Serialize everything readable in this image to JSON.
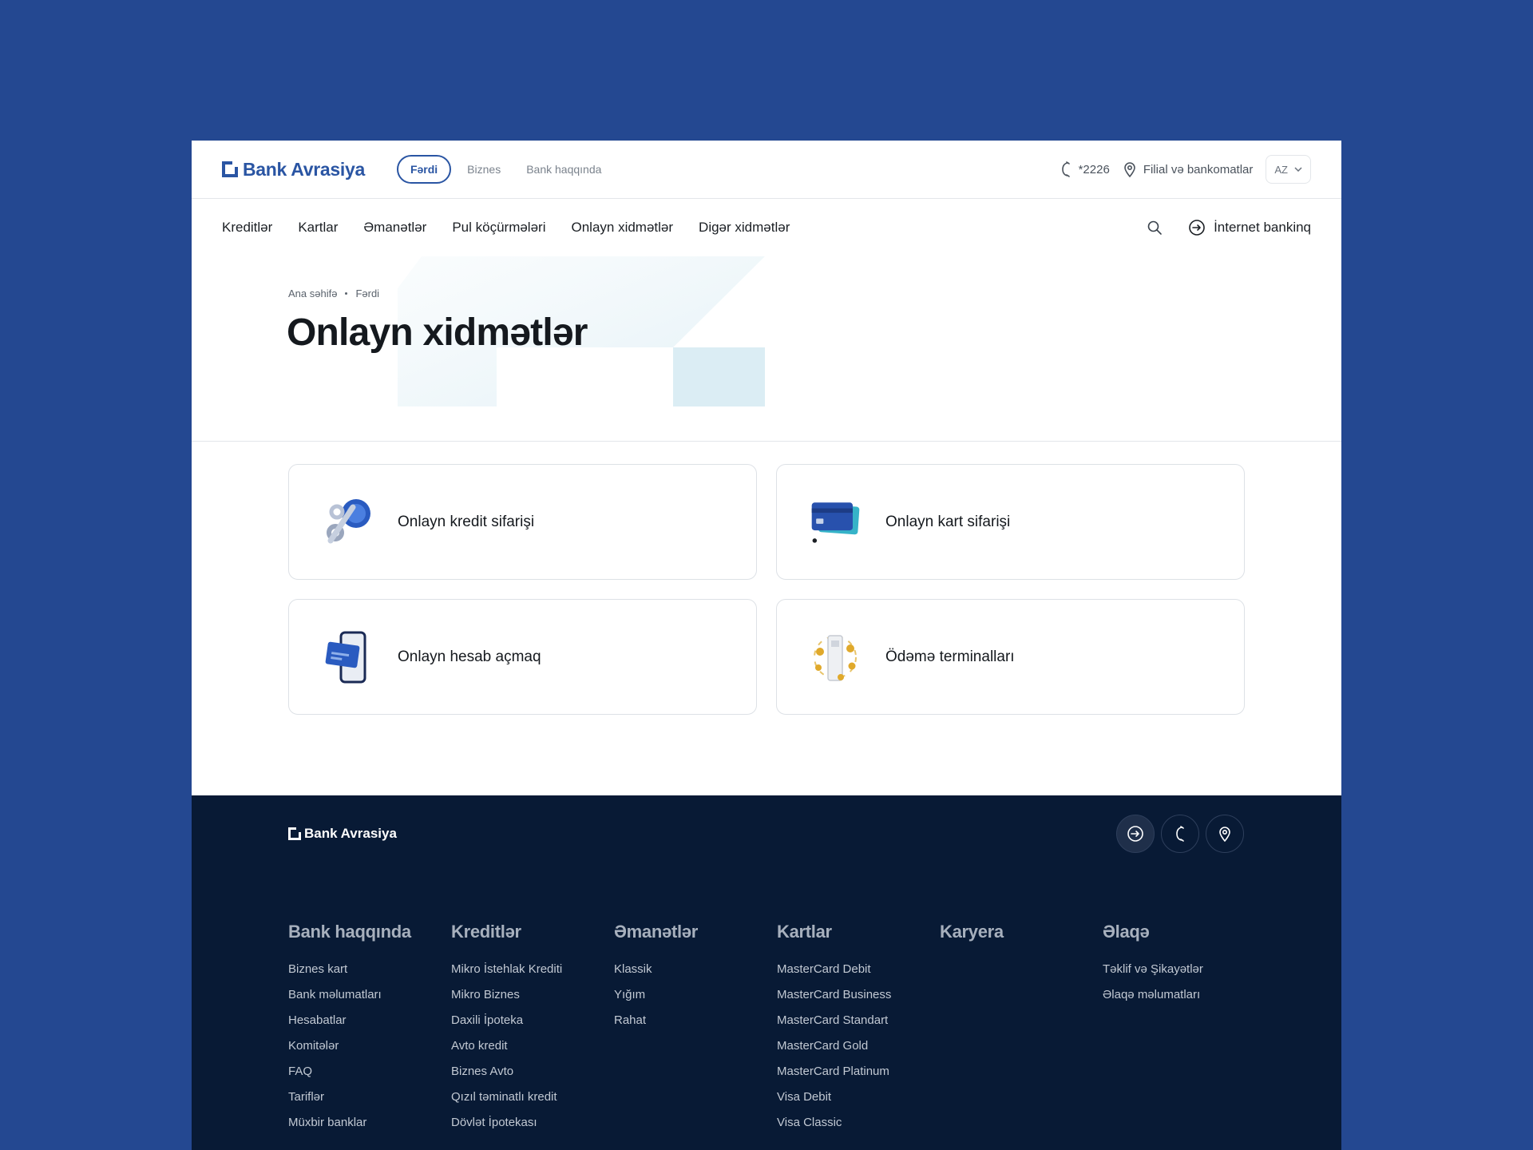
{
  "header": {
    "brand": "Bank Avrasiya",
    "segments": [
      "Fərdi",
      "Biznes",
      "Bank haqqında"
    ],
    "phone": "*2226",
    "branches": "Filial və bankomatlar",
    "lang": "AZ"
  },
  "nav": {
    "items": [
      "Kreditlər",
      "Kartlar",
      "Əmanətlər",
      "Pul köçürmələri",
      "Onlayn xidmətlər",
      "Digər xidmətlər"
    ],
    "internet_banking": "İnternet bankinq"
  },
  "breadcrumb": [
    "Ana səhifə",
    "Fərdi"
  ],
  "page_title": "Onlayn xidmətlər",
  "cards": [
    {
      "label": "Onlayn kredit sifarişi",
      "icon": "percent-coin-icon"
    },
    {
      "label": "Onlayn kart sifarişi",
      "icon": "credit-card-icon"
    },
    {
      "label": "Onlayn hesab açmaq",
      "icon": "phone-card-icon"
    },
    {
      "label": "Ödəmə terminalları",
      "icon": "payment-terminal-icon"
    }
  ],
  "footer": {
    "brand": "Bank Avrasiya",
    "columns": [
      {
        "title": "Bank haqqında",
        "links": [
          "Biznes kart",
          "Bank məlumatları",
          "Hesabatlar",
          "Komitələr",
          "FAQ",
          "Tariflər",
          "Müxbir banklar"
        ]
      },
      {
        "title": "Kreditlər",
        "links": [
          "Mikro İstehlak Krediti",
          "Mikro Biznes",
          "Daxili İpoteka",
          "Avto kredit",
          "Biznes Avto",
          "Qızıl təminatlı kredit",
          "Dövlət İpotekası"
        ]
      },
      {
        "title": "Əmanətlər",
        "links": [
          "Klassik",
          "Yığım",
          "Rahat"
        ]
      },
      {
        "title": "Kartlar",
        "links": [
          "MasterCard Debit",
          "MasterCard Business",
          "MasterCard Standart",
          "MasterCard Gold",
          "MasterCard Platinum",
          "Visa Debit",
          "Visa Classic"
        ]
      },
      {
        "title": "Karyera",
        "links": []
      },
      {
        "title": "Əlaqə",
        "links": [
          "Təklif və Şikayətlər",
          "Əlaqə məlumatları"
        ]
      }
    ]
  },
  "colors": {
    "brand": "#2a55a3",
    "page_bg": "#244891",
    "footer_bg": "#081a35"
  }
}
